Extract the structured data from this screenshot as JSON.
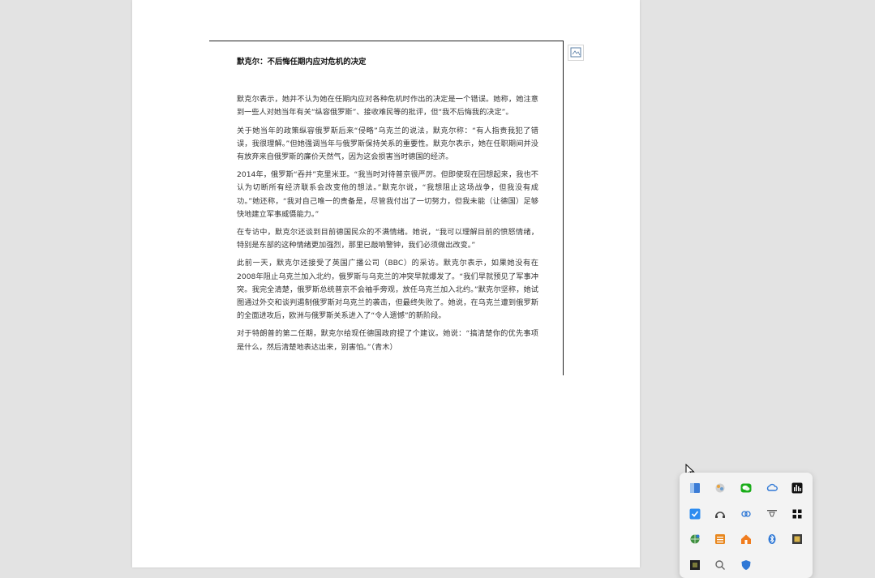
{
  "document": {
    "title": "默克尔：不后悔任期内应对危机的决定",
    "paragraphs": [
      "默克尔表示，她并不认为她在任期内应对各种危机时作出的决定是一个错误。她称，她注意到一些人对她当年有关“纵容俄罗斯”、接收难民等的批评，但“我不后悔我的决定”。",
      "关于她当年的政策纵容俄罗斯后来“侵略”乌克兰的说法，默克尔称：“有人指责我犯了错误，我很理解。”但她强调当年与俄罗斯保持关系的重要性。默克尔表示，她在任职期间并没有放弃来自俄罗斯的廉价天然气，因为这会损害当时德国的经济。",
      "2014年，俄罗斯“吞并”克里米亚。“我当时对待普京很严厉。但即使现在回想起来，我也不认为切断所有经济联系会改变他的想法。”默克尔说，“我想阻止这场战争，但我没有成功。”她还称，“我对自己唯一的责备是，尽管我付出了一切努力，但我未能（让德国）足够快地建立军事威慑能力。”",
      "在专访中，默克尔还谈到目前德国民众的不满情绪。她说，“我可以理解目前的愤怒情绪，特别是东部的这种情绪更加强烈，那里已敲响警钟，我们必须做出改变。”",
      "此前一天，默克尔还接受了英国广播公司（BBC）的采访。默克尔表示，如果她没有在2008年阻止乌克兰加入北约，俄罗斯与乌克兰的冲突早就爆发了。“我们早就预见了军事冲突。我完全清楚，俄罗斯总统普京不会袖手旁观，放任乌克兰加入北约。”默克尔坚称，她试图通过外交和谈判遏制俄罗斯对乌克兰的袭击，但最终失败了。她说，在乌克兰遭到俄罗斯的全面进攻后，欧洲与俄罗斯关系进入了“令人遗憾”的新阶段。",
      "对于特朗普的第二任期，默克尔给现任德国政府提了个建议。她说：“搞清楚你的优先事项是什么，然后清楚地表达出来，别害怕。”（青木）"
    ]
  },
  "tray": {
    "icons": [
      "blue-app-icon",
      "color-wheel-icon",
      "wechat-icon",
      "cloud-sync-icon",
      "audio-bars-icon",
      "blue-check-app-icon",
      "cat-headset-icon",
      "cloud-link-icon",
      "projector-icon",
      "bookmark-squares-icon",
      "network-globe-icon",
      "orange-stack-icon",
      "orange-home-icon",
      "bluetooth-icon",
      "film-app-icon",
      "dark-app-icon",
      "search-app-icon",
      "shield-app-icon"
    ]
  }
}
